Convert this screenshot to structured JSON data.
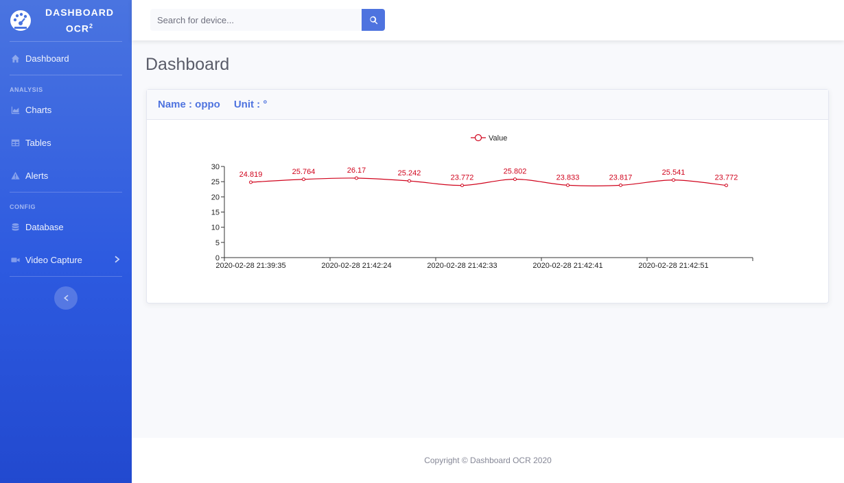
{
  "brand": {
    "line1": "DASHBOARD",
    "line2": "OCR",
    "superscript": "2",
    "icon": "dashboard-gauge-icon"
  },
  "sidebar": {
    "top_item": {
      "label": "Dashboard",
      "icon": "home-icon"
    },
    "sections": [
      {
        "heading": "ANALYSIS",
        "items": [
          {
            "label": "Charts",
            "icon": "area-chart-icon"
          },
          {
            "label": "Tables",
            "icon": "table-icon"
          },
          {
            "label": "Alerts",
            "icon": "warning-icon"
          }
        ]
      },
      {
        "heading": "CONFIG",
        "items": [
          {
            "label": "Database",
            "icon": "database-icon"
          },
          {
            "label": "Video Capture",
            "icon": "video-camera-icon"
          }
        ]
      }
    ]
  },
  "search": {
    "placeholder": "Search for device..."
  },
  "page": {
    "title": "Dashboard"
  },
  "card": {
    "name_text": "Name : oppo",
    "unit_text": "Unit : °"
  },
  "footer": {
    "copyright": "Copyright © Dashboard OCR 2020"
  },
  "colors": {
    "accent": "#4e73df",
    "series": "#d0021b",
    "sidebar_top": "#4a74e0",
    "sidebar_bottom": "#2249cf"
  },
  "chart_data": {
    "type": "line",
    "x": [
      "2020-02-28 21:39:35",
      "",
      "2020-02-28 21:42:24",
      "",
      "2020-02-28 21:42:33",
      "",
      "2020-02-28 21:42:41",
      "",
      "2020-02-28 21:42:51",
      ""
    ],
    "series": [
      {
        "name": "Value",
        "values": [
          24.819,
          25.764,
          26.17,
          25.242,
          23.772,
          25.802,
          23.833,
          23.817,
          25.541,
          23.772
        ]
      }
    ],
    "ylim": [
      0,
      30
    ],
    "yticks": [
      0,
      5,
      10,
      15,
      20,
      25,
      30
    ],
    "xtick_labels": [
      "2020-02-28 21:39:35",
      "2020-02-28 21:42:24",
      "2020-02-28 21:42:33",
      "2020-02-28 21:42:41",
      "2020-02-28 21:42:51"
    ],
    "legend": "top-center",
    "grid": false
  }
}
